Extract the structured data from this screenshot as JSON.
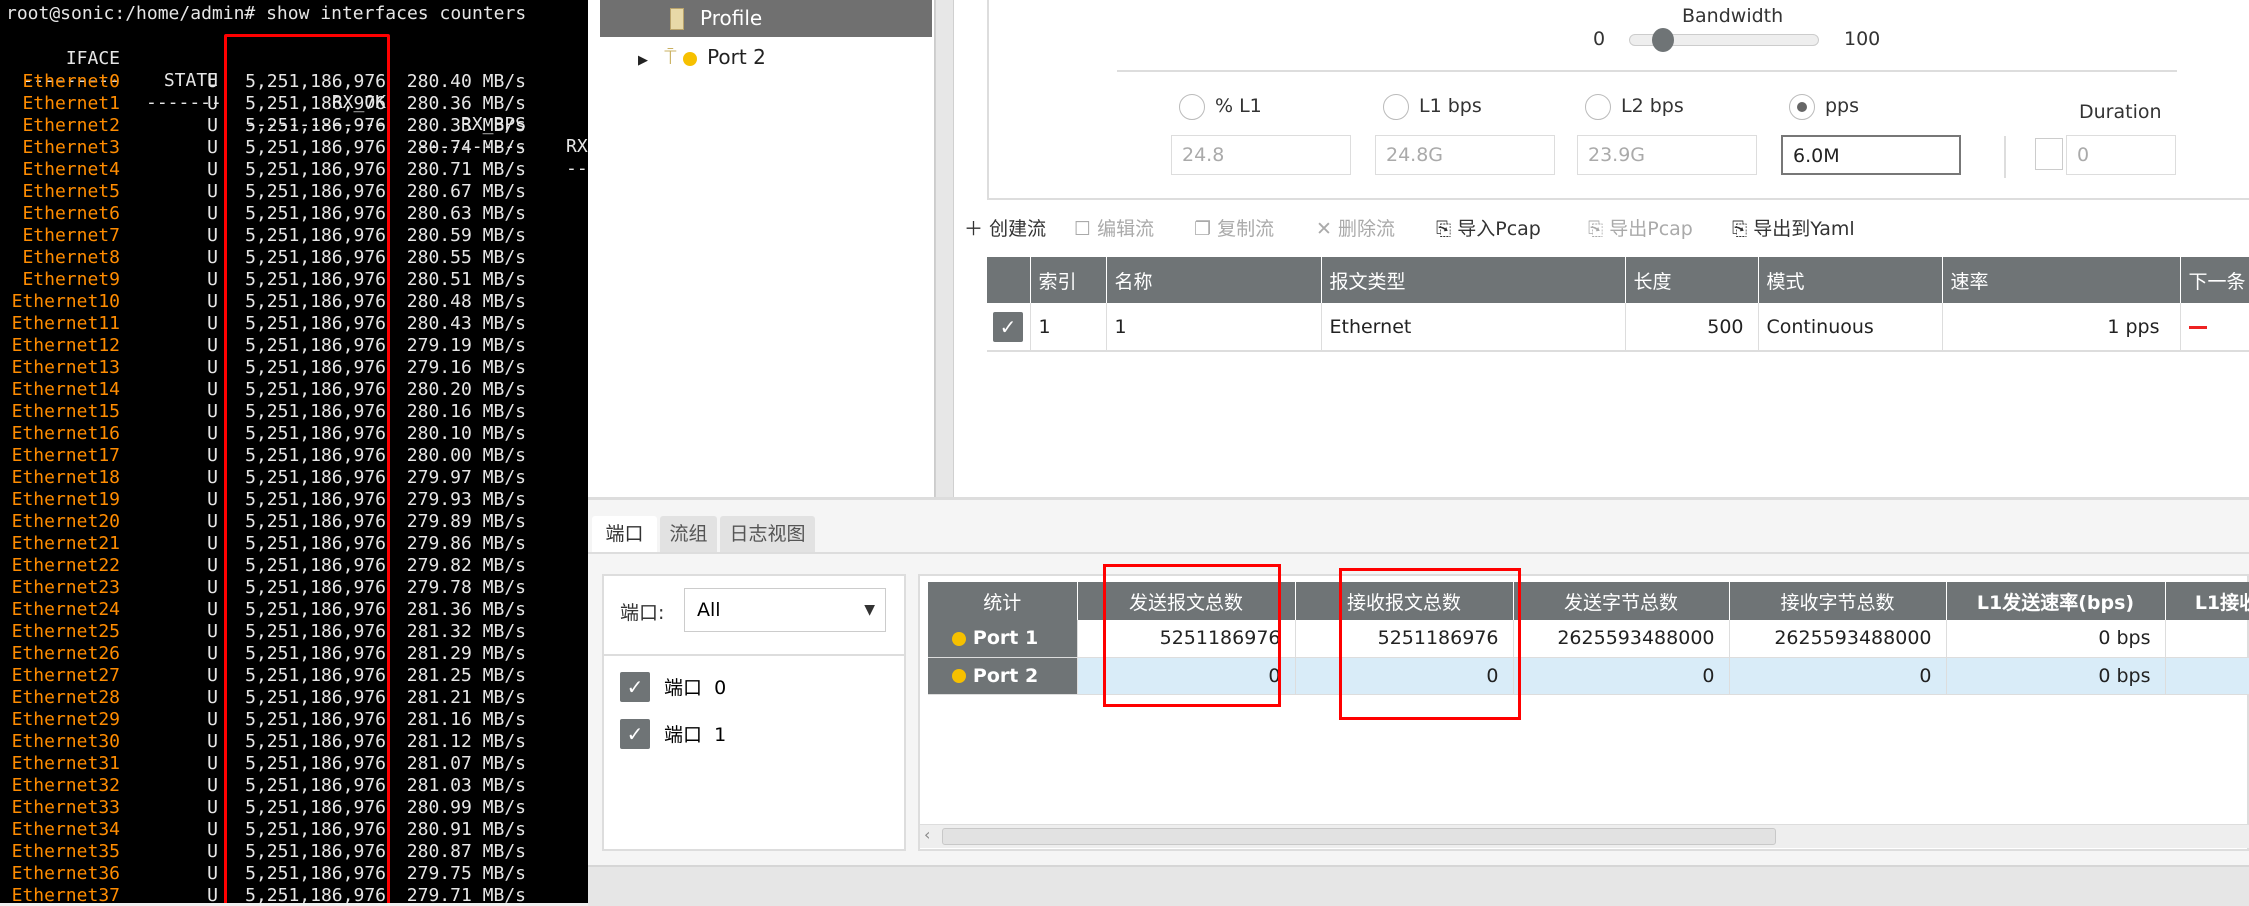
{
  "terminal": {
    "prompt": "root@sonic:/home/admin# show interfaces counters",
    "headers": {
      "iface": "IFACE",
      "state": "STATE",
      "rx_ok": "RX_OK",
      "rx_bps": "RX_BPS",
      "rx_more": "RX"
    },
    "dashes": {
      "iface": "---------",
      "state": "-------",
      "rx_ok": "-------------",
      "rx_bps": "----------",
      "rx_more": "----"
    },
    "rows": [
      [
        "Ethernet0",
        "U",
        "5,251,186,976",
        "280.40 MB/s"
      ],
      [
        "Ethernet1",
        "U",
        "5,251,186,976",
        "280.36 MB/s"
      ],
      [
        "Ethernet2",
        "U",
        "5,251,186,976",
        "280.33 MB/s"
      ],
      [
        "Ethernet3",
        "U",
        "5,251,186,976",
        "280.74 MB/s"
      ],
      [
        "Ethernet4",
        "U",
        "5,251,186,976",
        "280.71 MB/s"
      ],
      [
        "Ethernet5",
        "U",
        "5,251,186,976",
        "280.67 MB/s"
      ],
      [
        "Ethernet6",
        "U",
        "5,251,186,976",
        "280.63 MB/s"
      ],
      [
        "Ethernet7",
        "U",
        "5,251,186,976",
        "280.59 MB/s"
      ],
      [
        "Ethernet8",
        "U",
        "5,251,186,976",
        "280.55 MB/s"
      ],
      [
        "Ethernet9",
        "U",
        "5,251,186,976",
        "280.51 MB/s"
      ],
      [
        "Ethernet10",
        "U",
        "5,251,186,976",
        "280.48 MB/s"
      ],
      [
        "Ethernet11",
        "U",
        "5,251,186,976",
        "280.43 MB/s"
      ],
      [
        "Ethernet12",
        "U",
        "5,251,186,976",
        "279.19 MB/s"
      ],
      [
        "Ethernet13",
        "U",
        "5,251,186,976",
        "279.16 MB/s"
      ],
      [
        "Ethernet14",
        "U",
        "5,251,186,976",
        "280.20 MB/s"
      ],
      [
        "Ethernet15",
        "U",
        "5,251,186,976",
        "280.16 MB/s"
      ],
      [
        "Ethernet16",
        "U",
        "5,251,186,976",
        "280.10 MB/s"
      ],
      [
        "Ethernet17",
        "U",
        "5,251,186,976",
        "280.00 MB/s"
      ],
      [
        "Ethernet18",
        "U",
        "5,251,186,976",
        "279.97 MB/s"
      ],
      [
        "Ethernet19",
        "U",
        "5,251,186,976",
        "279.93 MB/s"
      ],
      [
        "Ethernet20",
        "U",
        "5,251,186,976",
        "279.89 MB/s"
      ],
      [
        "Ethernet21",
        "U",
        "5,251,186,976",
        "279.86 MB/s"
      ],
      [
        "Ethernet22",
        "U",
        "5,251,186,976",
        "279.82 MB/s"
      ],
      [
        "Ethernet23",
        "U",
        "5,251,186,976",
        "279.78 MB/s"
      ],
      [
        "Ethernet24",
        "U",
        "5,251,186,976",
        "281.36 MB/s"
      ],
      [
        "Ethernet25",
        "U",
        "5,251,186,976",
        "281.32 MB/s"
      ],
      [
        "Ethernet26",
        "U",
        "5,251,186,976",
        "281.29 MB/s"
      ],
      [
        "Ethernet27",
        "U",
        "5,251,186,976",
        "281.25 MB/s"
      ],
      [
        "Ethernet28",
        "U",
        "5,251,186,976",
        "281.21 MB/s"
      ],
      [
        "Ethernet29",
        "U",
        "5,251,186,976",
        "281.16 MB/s"
      ],
      [
        "Ethernet30",
        "U",
        "5,251,186,976",
        "281.12 MB/s"
      ],
      [
        "Ethernet31",
        "U",
        "5,251,186,976",
        "281.07 MB/s"
      ],
      [
        "Ethernet32",
        "U",
        "5,251,186,976",
        "281.03 MB/s"
      ],
      [
        "Ethernet33",
        "U",
        "5,251,186,976",
        "280.99 MB/s"
      ],
      [
        "Ethernet34",
        "U",
        "5,251,186,976",
        "280.91 MB/s"
      ],
      [
        "Ethernet35",
        "U",
        "5,251,186,976",
        "280.87 MB/s"
      ],
      [
        "Ethernet36",
        "U",
        "5,251,186,976",
        "279.75 MB/s"
      ],
      [
        "Ethernet37",
        "U",
        "5,251,186,976",
        "279.71 MB/s"
      ]
    ]
  },
  "tree": {
    "profile": "Profile",
    "port2": "Port 2"
  },
  "config": {
    "bandwidth_label": "Bandwidth",
    "slider_min": "0",
    "slider_max": "100",
    "slider_value_percent": 18,
    "modes": [
      {
        "label": "% L1",
        "value": "24.8"
      },
      {
        "label": "L1 bps",
        "value": "24.8G"
      },
      {
        "label": "L2 bps",
        "value": "23.9G"
      },
      {
        "label": "pps",
        "value": "6.0M",
        "selected": true
      }
    ],
    "duration_label": "Duration",
    "duration_value": "0"
  },
  "toolbar": {
    "create": "创建流",
    "edit": "编辑流",
    "copy": "复制流",
    "delete": "删除流",
    "import_pcap": "导入Pcap",
    "export_pcap": "导出Pcap",
    "export_yaml": "导出到Yaml"
  },
  "flow_table": {
    "headers": [
      "索引",
      "名称",
      "报文类型",
      "长度",
      "模式",
      "速率",
      "下一条"
    ],
    "rows": [
      {
        "index": "1",
        "name": "1",
        "type": "Ethernet",
        "length": "500",
        "mode": "Continuous",
        "rate": "1 pps"
      }
    ]
  },
  "tabs": [
    "端口",
    "流组",
    "日志视图"
  ],
  "port_filter": {
    "label": "端口:",
    "selected": "All",
    "ports": [
      "端口  0",
      "端口  1"
    ]
  },
  "stats": {
    "headers": [
      "统计",
      "发送报文总数",
      "接收报文总数",
      "发送字节总数",
      "接收字节总数",
      "L1发送速率(bps)",
      "L1接收"
    ],
    "rows": [
      {
        "port": "Port 1",
        "tx_pkts": "5251186976",
        "rx_pkts": "5251186976",
        "tx_bytes": "2625593488000",
        "rx_bytes": "2625593488000",
        "l1_tx": "0 bps"
      },
      {
        "port": "Port 2",
        "tx_pkts": "0",
        "rx_pkts": "0",
        "tx_bytes": "0",
        "rx_bytes": "0",
        "l1_tx": "0 bps"
      }
    ]
  },
  "colors": {
    "highlight": "#ff0000",
    "port_status": "#f6c000",
    "header_bg": "#6f7476",
    "iface": "#ff8c00"
  }
}
